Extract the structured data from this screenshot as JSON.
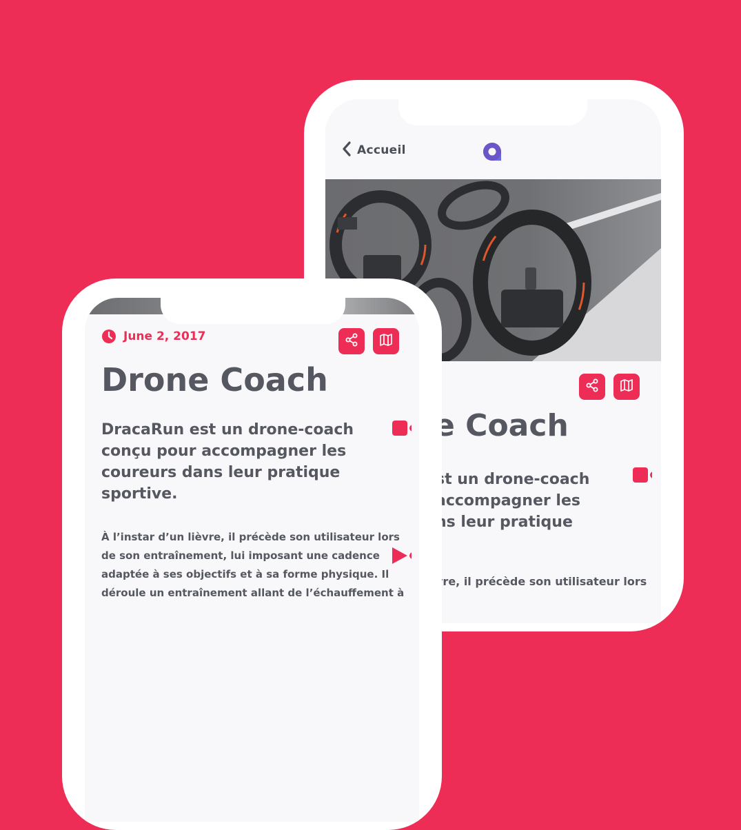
{
  "colors": {
    "background": "#ee2d56",
    "accent": "#ee2d56",
    "text": "#555860",
    "screen": "#f8f8fa"
  },
  "back_phone": {
    "nav": {
      "back_label": "Accueil",
      "back_icon": "chevron-left-icon",
      "logo": "app-logo"
    },
    "hero_image": "drone-coach-product-render",
    "actions": [
      {
        "icon": "share-icon"
      },
      {
        "icon": "map-icon"
      }
    ],
    "title_partial": "e Coach",
    "lead_lines": [
      "st un drone-coach",
      "accompagner les",
      "ns leur pratique"
    ],
    "body_line": "vre, il précède son utilisateur lors"
  },
  "front_phone": {
    "date": "June 2, 2017",
    "date_icon": "clock-icon",
    "actions": [
      {
        "icon": "share-icon"
      },
      {
        "icon": "map-icon"
      }
    ],
    "title": "Drone Coach",
    "lead_lines": [
      "DracaRun est un drone-coach",
      "conçu pour accompagner les",
      "coureurs dans leur pratique",
      "sportive."
    ],
    "body_lines": [
      "À l’instar d’un lièvre, il précède son utilisateur lors",
      "de son entraînement, lui imposant une cadence",
      "adaptée à ses objectifs et à sa forme physique. Il",
      "déroule un entraînement allant de l’échauffement à"
    ]
  }
}
